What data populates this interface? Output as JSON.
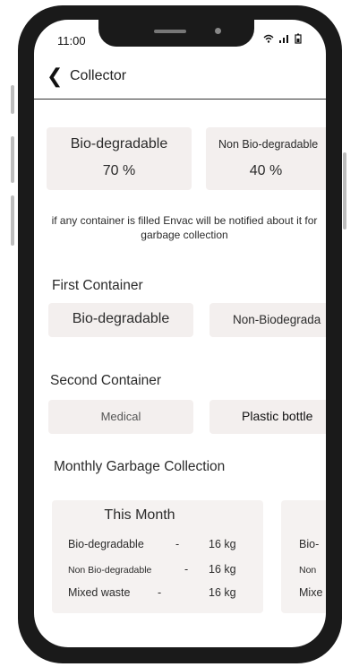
{
  "status_bar": {
    "time": "11:00",
    "icons": "wifi-icon signal-icon battery-icon"
  },
  "header": {
    "title": "Collector"
  },
  "levels": [
    {
      "name": "Bio-degradable",
      "value": "70 %"
    },
    {
      "name": "Non Bio-degradable",
      "value": "40 %"
    }
  ],
  "notice": "if any container is filled Envac will be notified about it for garbage collection",
  "first_container": {
    "title": "First Container",
    "options": [
      "Bio-degradable",
      "Non-Biodegrada"
    ]
  },
  "second_container": {
    "title": "Second Container",
    "options": [
      "Medical",
      "Plastic bottle"
    ]
  },
  "monthly": {
    "title": "Monthly Garbage Collection",
    "cards": [
      {
        "title": "This Month",
        "rows": [
          {
            "label": "Bio-degradable",
            "dash": "-",
            "value": "16 kg"
          },
          {
            "label": "Non Bio-degradable",
            "dash": "-",
            "value": "16 kg"
          },
          {
            "label": "Mixed waste",
            "dash": "-",
            "value": "16 kg"
          }
        ]
      },
      {
        "rows": [
          {
            "label": "Bio-"
          },
          {
            "label": "Non"
          },
          {
            "label": "Mixe"
          }
        ]
      }
    ]
  }
}
